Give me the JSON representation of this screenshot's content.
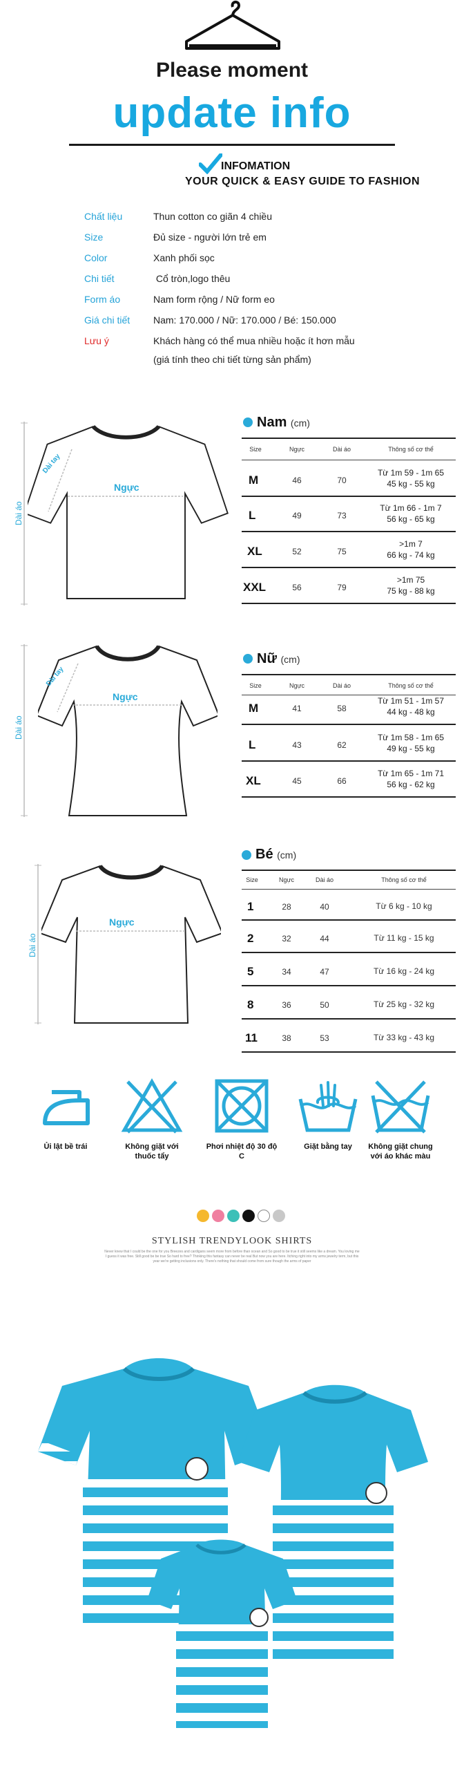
{
  "header": {
    "hanger_icon": "hanger-icon",
    "please_moment": "Please moment",
    "update_info": "update info",
    "check_icon": "checkmark-icon",
    "infomation": "INFOMATION",
    "guide": "YOUR QUICK & EASY GUIDE TO FASHION"
  },
  "info": [
    {
      "label": "Chất liệu",
      "value": "Thun cotton co giãn 4 chiều"
    },
    {
      "label": "Size",
      "value": "Đủ size - người lớn trẻ em"
    },
    {
      "label": "Color",
      "value": "Xanh phối sọc"
    },
    {
      "label": "Chi tiết",
      "value": " Cổ tròn,logo thêu"
    },
    {
      "label": "Form áo",
      "value": "Nam form rộng / Nữ form eo"
    },
    {
      "label": "Giá chi tiết",
      "value": "Nam: 170.000 / Nữ: 170.000 / Bé: 150.000"
    },
    {
      "label": "Lưu ý",
      "value": "Khách hàng có thể mua nhiều hoặc ít hơn mẫu"
    }
  ],
  "info_note2": "(giá tính theo chi tiết từng sản phẩm)",
  "shirt_labels": {
    "chest": "Ngực",
    "length": "Dài áo",
    "width": "Dài tay"
  },
  "tables": {
    "nam": {
      "title": "Nam",
      "unit": "(cm)",
      "headers": [
        "Size",
        "Ngực",
        "Dài áo",
        "Thông số cơ thể"
      ],
      "rows": [
        {
          "size": "M",
          "chest": "46",
          "length": "70",
          "d1": "Từ 1m 59 - 1m 65",
          "d2": "45 kg - 55 kg"
        },
        {
          "size": "L",
          "chest": "49",
          "length": "73",
          "d1": "Từ 1m 66 - 1m 7",
          "d2": "56 kg - 65 kg"
        },
        {
          "size": "XL",
          "chest": "52",
          "length": "75",
          "d1": ">1m 7",
          "d2": "66 kg - 74 kg"
        },
        {
          "size": "XXL",
          "chest": "56",
          "length": "79",
          "d1": ">1m 75",
          "d2": "75 kg - 88 kg"
        }
      ]
    },
    "nu": {
      "title": "Nữ",
      "unit": "(cm)",
      "headers": [
        "Size",
        "Ngực",
        "Dài áo",
        "Thông số cơ thể"
      ],
      "rows": [
        {
          "size": "M",
          "chest": "41",
          "length": "58",
          "d1": "Từ 1m 51 - 1m 57",
          "d2": "44 kg - 48 kg"
        },
        {
          "size": "L",
          "chest": "43",
          "length": "62",
          "d1": "Từ 1m 58 - 1m 65",
          "d2": "49 kg - 55 kg"
        },
        {
          "size": "XL",
          "chest": "45",
          "length": "66",
          "d1": "Từ 1m 65 - 1m 71",
          "d2": "56 kg - 62 kg"
        }
      ]
    },
    "be": {
      "title": "Bé",
      "unit": "(cm)",
      "headers": [
        "Size",
        "Ngực",
        "Dài áo",
        "Thông số cơ thể"
      ],
      "rows": [
        {
          "size": "1",
          "chest": "28",
          "length": "40",
          "d1": "Từ 6 kg - 10 kg"
        },
        {
          "size": "2",
          "chest": "32",
          "length": "44",
          "d1": "Từ  11 kg - 15 kg"
        },
        {
          "size": "5",
          "chest": "34",
          "length": "47",
          "d1": "Từ  16 kg - 24 kg"
        },
        {
          "size": "8",
          "chest": "36",
          "length": "50",
          "d1": "Từ 25 kg - 32 kg"
        },
        {
          "size": "11",
          "chest": "38",
          "length": "53",
          "d1": "Từ 33 kg - 43 kg"
        }
      ]
    }
  },
  "care": [
    {
      "icon": "iron-icon",
      "label": "Ủi lật bề trái"
    },
    {
      "icon": "no-bleach-icon",
      "label": "Không giặt với thuốc tẩy"
    },
    {
      "icon": "no-tumble-dry-icon",
      "label": "Phơi nhiệt độ 30 độ C"
    },
    {
      "icon": "hand-wash-icon",
      "label": "Giặt bằng tay"
    },
    {
      "icon": "wash-separately-icon",
      "label": "Không giặt chung với áo khác màu"
    }
  ],
  "swatches": [
    "#f5b82e",
    "#f07fa0",
    "#3cc0b8",
    "#111111",
    "#ffffff",
    "#c8c8c8"
  ],
  "stylish": "STYLISH TRENDYLOOK SHIRTS",
  "fine_print": "Never knew that I could be the one for you Breezes and cardigans seem more from before than ocean and So good to be true it still seems like a dream. You loving me I guess it was free. Still good be be true So hard to free? Thinking this fantasy can never be real But now you are here. Itching right into my arms jewelry term, but this year we're getting inclusions only. There's nothing that should come from sure though the arms of paper",
  "shirt_colors": {
    "blue": "#2fb3dc",
    "stripe": "#2fb3dc",
    "white": "#ffffff"
  }
}
